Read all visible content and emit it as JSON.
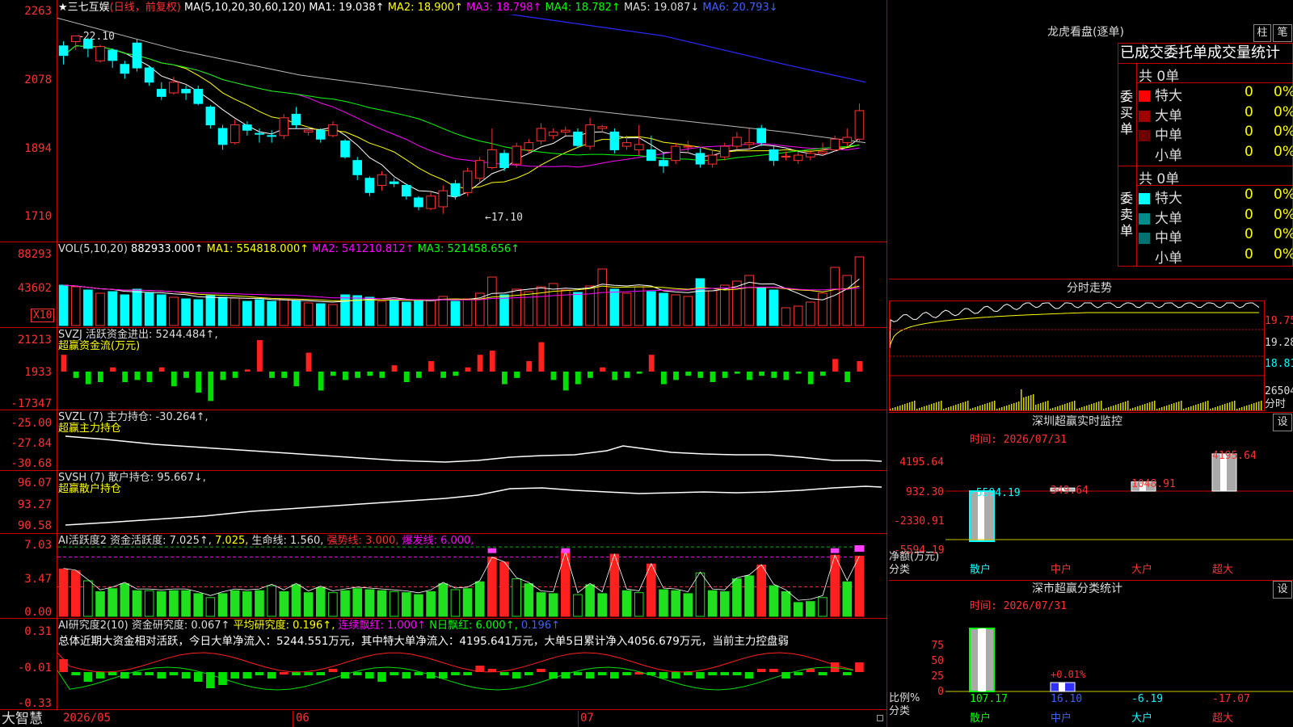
{
  "stock": {
    "name": "三七互娱",
    "mode": "(日线，前复权)",
    "star": "★"
  },
  "kline": {
    "ma_label": "MA(5,10,20,30,60,120)",
    "ma1": "MA1: 19.038↑",
    "ma2": "MA2: 18.900↑",
    "ma3": "MA3: 18.798↑",
    "ma4": "MA4: 18.782↑",
    "ma5": "MA5: 19.087↓",
    "ma6": "MA6: 20.793↓",
    "yticks": [
      "2263",
      "2078",
      "1894",
      "1710"
    ],
    "hi": "22.10",
    "lo": "17.10",
    "candles": [
      [
        21.82,
        21.55,
        21.95,
        21.3
      ],
      [
        21.94,
        22.1,
        22.06,
        21.7
      ],
      [
        22.0,
        21.75,
        22.05,
        21.5
      ],
      [
        21.4,
        21.8,
        21.85,
        21.35
      ],
      [
        21.7,
        21.41,
        21.75,
        21.2
      ],
      [
        21.3,
        21.05,
        21.4,
        20.9
      ],
      [
        21.9,
        21.2,
        22.0,
        21.1
      ],
      [
        21.2,
        20.8,
        21.25,
        20.7
      ],
      [
        20.6,
        20.4,
        20.8,
        20.3
      ],
      [
        20.5,
        20.8,
        20.95,
        20.45
      ],
      [
        20.6,
        20.5,
        20.7,
        20.3
      ],
      [
        20.6,
        20.2,
        20.7,
        20.15
      ],
      [
        20.1,
        19.6,
        20.15,
        19.5
      ],
      [
        19.5,
        19.05,
        19.6,
        18.9
      ],
      [
        19.1,
        19.6,
        19.75,
        19.05
      ],
      [
        19.6,
        19.45,
        19.7,
        19.3
      ],
      [
        19.36,
        19.34,
        19.5,
        19.1
      ],
      [
        19.3,
        19.28,
        19.45,
        19.1
      ],
      [
        19.3,
        19.8,
        19.9,
        19.2
      ],
      [
        19.9,
        19.6,
        20.1,
        19.5
      ],
      [
        19.4,
        19.45,
        19.55,
        19.3
      ],
      [
        19.45,
        19.2,
        19.5,
        19.1
      ],
      [
        19.3,
        19.6,
        19.7,
        19.25
      ],
      [
        19.15,
        18.7,
        19.2,
        18.65
      ],
      [
        18.6,
        18.2,
        18.7,
        18.05
      ],
      [
        18.1,
        17.7,
        18.15,
        17.6
      ],
      [
        17.9,
        18.2,
        18.3,
        17.75
      ],
      [
        18.0,
        17.95,
        18.1,
        17.85
      ],
      [
        17.9,
        17.6,
        17.95,
        17.5
      ],
      [
        17.55,
        17.3,
        17.6,
        17.2
      ],
      [
        17.25,
        17.6,
        17.7,
        17.2
      ],
      [
        17.3,
        17.75,
        17.9,
        17.1
      ],
      [
        17.95,
        17.6,
        18.05,
        17.5
      ],
      [
        17.7,
        18.3,
        18.4,
        17.6
      ],
      [
        18.1,
        18.6,
        18.7,
        18.0
      ],
      [
        18.4,
        18.9,
        19.5,
        18.35
      ],
      [
        18.8,
        18.4,
        18.9,
        18.3
      ],
      [
        18.5,
        19.0,
        19.1,
        18.4
      ],
      [
        18.9,
        19.1,
        19.2,
        18.8
      ],
      [
        19.15,
        19.5,
        19.65,
        19.05
      ],
      [
        19.3,
        19.4,
        19.5,
        19.2
      ],
      [
        19.4,
        19.45,
        19.55,
        19.3
      ],
      [
        19.4,
        19.02,
        19.5,
        18.95
      ],
      [
        19.0,
        19.6,
        19.8,
        18.9
      ],
      [
        19.5,
        19.55,
        19.6,
        19.4
      ],
      [
        19.4,
        18.9,
        19.5,
        18.8
      ],
      [
        19.0,
        19.1,
        19.3,
        18.9
      ],
      [
        18.9,
        19.05,
        19.6,
        18.75
      ],
      [
        18.9,
        18.6,
        19.3,
        18.6
      ],
      [
        18.6,
        18.45,
        18.8,
        18.25
      ],
      [
        18.6,
        19.0,
        19.1,
        18.5
      ],
      [
        19.0,
        19.0,
        19.15,
        18.8
      ],
      [
        18.8,
        18.5,
        18.95,
        18.4
      ],
      [
        18.5,
        18.75,
        18.9,
        18.4
      ],
      [
        18.7,
        19.0,
        19.1,
        18.6
      ],
      [
        19.0,
        19.25,
        19.4,
        18.9
      ],
      [
        19.05,
        19.1,
        19.5,
        18.85
      ],
      [
        19.5,
        19.1,
        19.6,
        19.0
      ],
      [
        18.9,
        18.6,
        19.0,
        18.45
      ],
      [
        18.7,
        18.72,
        18.85,
        18.6
      ],
      [
        18.6,
        18.75,
        18.85,
        18.5
      ],
      [
        18.7,
        18.8,
        18.9,
        18.6
      ],
      [
        18.8,
        18.85,
        19.1,
        18.75
      ],
      [
        18.9,
        19.2,
        19.3,
        18.85
      ],
      [
        19.1,
        19.25,
        19.5,
        19.0
      ],
      [
        19.2,
        20.0,
        20.2,
        19.1
      ]
    ],
    "ma_colors": [
      "#ffffff",
      "#ffff00",
      "#ff00ff",
      "#00ff00",
      "#cccccc",
      "#4040ff"
    ]
  },
  "vol": {
    "label": "VOL(5,10,20)",
    "v0": "882933.000↑",
    "ma1": "MA1: 554818.000↑",
    "ma2": "MA2: 541210.812↑",
    "ma3": "MA3: 521458.656↑",
    "yticks": [
      "88293",
      "43602"
    ],
    "x10": "X10",
    "bars": [
      50,
      48,
      44,
      40,
      42,
      38,
      45,
      40,
      38,
      35,
      33,
      32,
      37,
      35,
      34,
      30,
      32,
      30,
      33,
      31,
      28,
      27,
      26,
      38,
      37,
      35,
      30,
      32,
      29,
      31,
      32,
      36,
      30,
      33,
      40,
      60,
      38,
      45,
      42,
      48,
      52,
      44,
      41,
      49,
      70,
      45,
      40,
      48,
      42,
      40,
      38,
      36,
      58,
      43,
      50,
      55,
      62,
      47,
      44,
      22,
      24,
      29,
      40,
      72,
      62,
      85
    ]
  },
  "svzj": {
    "label": "SVZJ  活跃资金进出: 5244.484↑,",
    "sub": "超赢资金流(万元)",
    "yticks": [
      "21213",
      "1933",
      "-17347"
    ],
    "bars": [
      8,
      -3,
      -6,
      -5,
      2,
      -5,
      -4,
      -5,
      2,
      -7,
      -3,
      -10,
      -14,
      -4,
      -3,
      1,
      15,
      -3,
      -3,
      -7,
      9,
      -9,
      -2,
      -4,
      -3,
      -2,
      -3,
      3,
      -5,
      -3,
      5,
      -3,
      -2,
      2,
      8,
      10,
      -6,
      -3,
      5,
      14,
      -4,
      -9,
      -6,
      -3,
      2,
      -4,
      -3,
      -1,
      8,
      -6,
      -4,
      -2,
      -3,
      -5,
      -3,
      -1,
      -4,
      -2,
      -3,
      -4,
      -1,
      -6,
      -2,
      6,
      -5,
      5
    ]
  },
  "svzl": {
    "label": "SVZL (7) 主力持仓: -30.264↑,",
    "sub": "超赢主力持仓",
    "yticks": [
      "-25.00",
      "-27.84",
      "-30.68"
    ]
  },
  "svsh": {
    "label": "SVSH (7) 散户持仓: 95.667↓,",
    "sub": "超赢散户持仓",
    "yticks": [
      "96.07",
      "93.27",
      "90.58"
    ]
  },
  "ai1": {
    "label": "AI活跃度2 资金活跃度: 7.025↑,",
    "v2": "7.025,",
    "life": "生命线: 1.560,",
    "strong": "强势线: 3.000,",
    "burst": "爆发线: 6.000,",
    "yticks": [
      "7.03",
      "3.47",
      "0.00"
    ]
  },
  "ai2": {
    "label": "AI研究度2(10) 资金研究度: 0.067↑",
    "avg": "平均研究度: 0.196↑,",
    "lianxu": "连续飘红: 1.000↑",
    "nri": "N日飘红: 6.000↑,",
    "last": "0.196↑",
    "comment": "总体近期大资金相对活跃，今日大单净流入：5244.551万元，其中特大单净流入：4195.641万元，大单5日累计净入4056.679万元，当前主力控盘弱",
    "yticks": [
      "0.31",
      "-0.01",
      "-0.33"
    ]
  },
  "xaxis": {
    "brand": "大智慧",
    "labels": [
      "2026/05",
      "06",
      "07"
    ]
  },
  "longhu": {
    "title": "龙虎看盘(逐单)",
    "btn_zhu": "柱",
    "btn_bi": "笔",
    "header": "已成交委托单成交量统计",
    "buy": {
      "label": "委买单",
      "total": "共 0单",
      "rows": [
        [
          "特大",
          "0",
          "0%",
          "#ff0000"
        ],
        [
          "大单",
          "0",
          "0%",
          "#a00000"
        ],
        [
          "中单",
          "0",
          "0%",
          "#700000"
        ],
        [
          "小单",
          "0",
          "0%",
          ""
        ]
      ]
    },
    "sell": {
      "label": "委卖单",
      "total": "共 0单",
      "rows": [
        [
          "特大",
          "0",
          "0%",
          "#00ffff"
        ],
        [
          "大单",
          "0",
          "0%",
          "#008b8b"
        ],
        [
          "中单",
          "0",
          "0%",
          "#007070"
        ],
        [
          "小单",
          "0",
          "0%",
          ""
        ]
      ]
    }
  },
  "fenshi": {
    "title": "分时走势",
    "yticks": [
      "19.75",
      "19.28",
      "18.81"
    ],
    "vol": "26504",
    "vlabel": "分时"
  },
  "szmon": {
    "title": "深圳超赢实时监控",
    "btn": "设",
    "time": "时间: 2026/07/31",
    "yticks": [
      "4195.64",
      "932.30",
      "-2330.91",
      "-5594.19"
    ],
    "ylabel": "净额(万元)",
    "xlabel": "分类",
    "cats": [
      "散户",
      "中户",
      "大户",
      "超大"
    ],
    "vals": [
      "-5594.19",
      "349.64",
      "1048.91",
      "4195.64"
    ],
    "nums": [
      -5594.19,
      349.64,
      1048.91,
      4195.64
    ]
  },
  "szcls": {
    "title": "深市超赢分类统计",
    "btn": "设",
    "time": "时间: 2026/07/31",
    "yticks": [
      "75",
      "50",
      "25",
      "0"
    ],
    "ylabel": "比例%",
    "xlabel": "分类",
    "cats": [
      "散户",
      "中户",
      "大户",
      "超大"
    ],
    "vals": [
      "107.17",
      "16.10",
      "-6.19",
      "-17.07"
    ],
    "nums": [
      107.17,
      16.1,
      -6.19,
      -17.07
    ],
    "note": "+0.01%"
  }
}
